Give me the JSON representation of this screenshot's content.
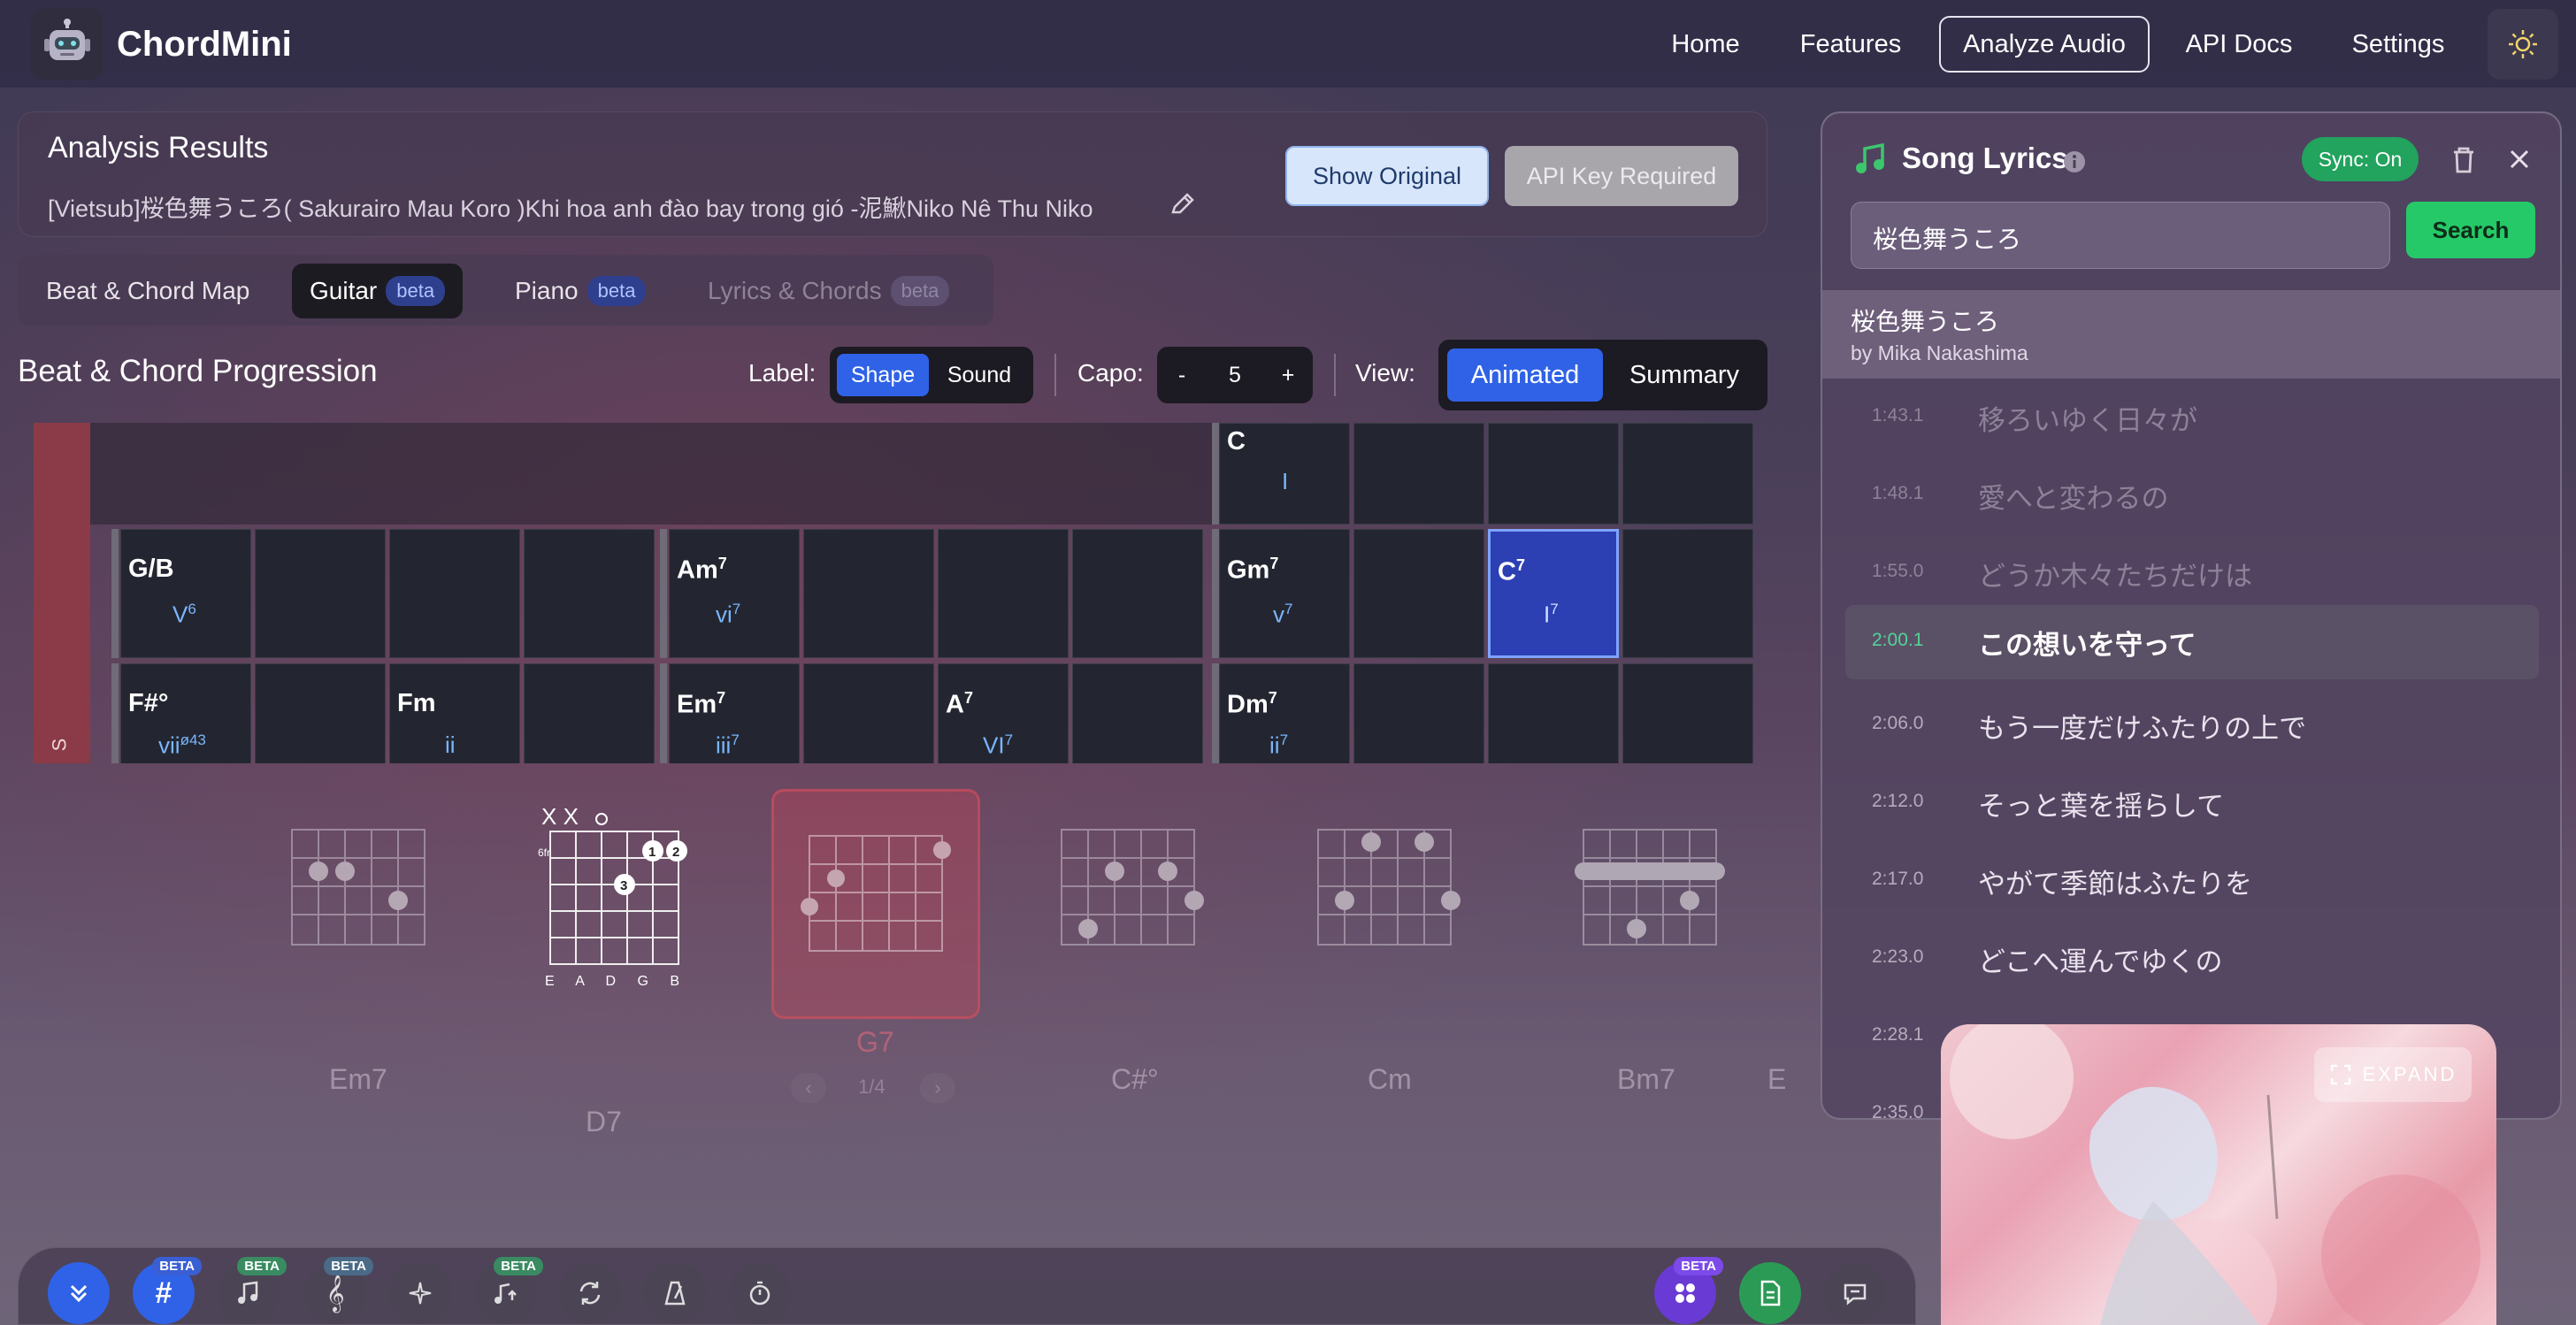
{
  "app": {
    "title": "ChordMini"
  },
  "nav": {
    "home": "Home",
    "features": "Features",
    "analyze": "Analyze Audio",
    "api": "API Docs",
    "settings": "Settings"
  },
  "analysis": {
    "title": "Analysis Results",
    "subtitle": "[Vietsub]桜色舞うころ( Sakurairo Mau Koro )Khi hoa anh đào bay trong gió -泥鰍Niko Nê Thu Niko",
    "show_original": "Show Original",
    "api_key": "API Key Required"
  },
  "tabs": [
    {
      "label": "Beat & Chord Map"
    },
    {
      "label": "Guitar",
      "badge": "beta"
    },
    {
      "label": "Piano",
      "badge": "beta"
    },
    {
      "label": "Lyrics & Chords",
      "badge": "beta"
    }
  ],
  "progression": {
    "title": "Beat & Chord Progression",
    "label_label": "Label:",
    "shape": "Shape",
    "sound": "Sound",
    "capo_label": "Capo:",
    "capo_minus": "-",
    "capo_value": "5",
    "capo_plus": "+",
    "view_label": "View:",
    "animated": "Animated",
    "summary": "Summary",
    "section_label": "S"
  },
  "grid": {
    "row0": [
      {
        "chord": "C",
        "roman": "I"
      }
    ],
    "row1": [
      {
        "chord": "G/B",
        "roman": "V",
        "roman_sup": "6"
      },
      {
        "chord": "Am",
        "sup": "7",
        "roman": "vi",
        "roman_sup": "7"
      },
      {
        "chord": "Gm",
        "sup": "7",
        "roman": "v",
        "roman_sup": "7"
      },
      {
        "chord": "C",
        "sup": "7",
        "roman": "I",
        "roman_sup": "7"
      }
    ],
    "row2": [
      {
        "chord": "F#°",
        "roman": "vii",
        "roman_sup": "ø43"
      },
      {
        "chord": "Fm",
        "roman": "ii"
      },
      {
        "chord": "Em",
        "sup": "7",
        "roman": "iii",
        "roman_sup": "7"
      },
      {
        "chord": "A",
        "sup": "7",
        "roman": "VI",
        "roman_sup": "7"
      },
      {
        "chord": "Dm",
        "sup": "7",
        "roman": "ii",
        "roman_sup": "7"
      }
    ]
  },
  "diagrams": {
    "strings": "E A D G B E",
    "fret_label": "6fr",
    "mute_marks": "X X",
    "labels": [
      "Em7",
      "D7",
      "G7",
      "C#°",
      "Cm",
      "Bm7",
      "E"
    ],
    "pager": "1/4"
  },
  "lyrics": {
    "title": "Song Lyrics",
    "sync": "Sync: On",
    "search_value": "桜色舞うころ",
    "search_button": "Search",
    "song": "桜色舞うころ",
    "artist": "by Mika Nakashima",
    "lines": [
      {
        "time": "1:43.1",
        "text": "移ろいゆく日々が"
      },
      {
        "time": "1:48.1",
        "text": "愛へと変わるの"
      },
      {
        "time": "1:55.0",
        "text": "どうか木々たちだけは"
      },
      {
        "time": "2:00.1",
        "text": "この想いを守って"
      },
      {
        "time": "2:06.0",
        "text": "もう一度だけふたりの上で"
      },
      {
        "time": "2:12.0",
        "text": "そっと葉を揺らして"
      },
      {
        "time": "2:17.0",
        "text": "やがて季節はふたりを"
      },
      {
        "time": "2:23.0",
        "text": "どこへ運んでゆくの"
      },
      {
        "time": "2:28.1",
        "text": ""
      },
      {
        "time": "2:35.0",
        "text": ""
      }
    ]
  },
  "video": {
    "expand": "EXPAND"
  },
  "toolbar": {
    "beta": "BETA"
  },
  "colors": {
    "accent": "#2f62e6",
    "green": "#22a35e",
    "section": "#8a3b47"
  }
}
